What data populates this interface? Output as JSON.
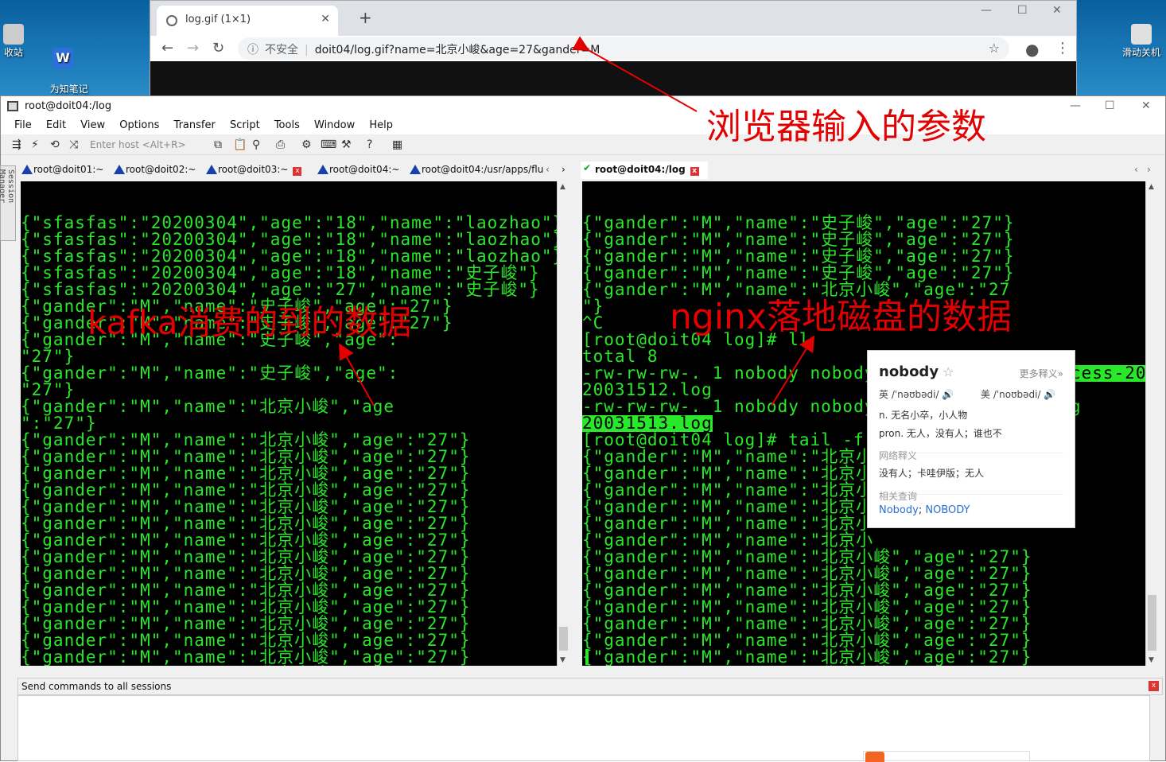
{
  "desktop": {
    "icons": [
      {
        "label": "收站"
      },
      {
        "label": "为知笔记\nWiz"
      },
      {
        "label": "滑动关机"
      }
    ]
  },
  "browser": {
    "tab_title": "log.gif (1×1)",
    "insecure_label": "不安全",
    "url": "doit04/log.gif?name=北京小峻&age=27&gander=M"
  },
  "terminal": {
    "window_title": "root@doit04:/log",
    "menu": [
      "File",
      "Edit",
      "View",
      "Options",
      "Transfer",
      "Script",
      "Tools",
      "Window",
      "Help"
    ],
    "enter_host_placeholder": "Enter host <Alt+R>",
    "session_manager_label": "Session Manager",
    "left_tabs": [
      "root@doit01:~",
      "root@doit02:~",
      "root@doit03:~",
      "root@doit04:~",
      "root@doit04:/usr/apps/flu"
    ],
    "right_tab": "root@doit04:/log",
    "left_lines": [
      "{\"sfasfas\":\"20200304\",\"age\":\"18\",\"name\":\"laozhao\"}",
      "{\"sfasfas\":\"20200304\",\"age\":\"18\",\"name\":\"laozhao\"}",
      "{\"sfasfas\":\"20200304\",\"age\":\"18\",\"name\":\"laozhao\"}",
      "{\"sfasfas\":\"20200304\",\"age\":\"18\",\"name\":\"史子峻\"}",
      "{\"sfasfas\":\"20200304\",\"age\":\"27\",\"name\":\"史子峻\"}",
      "{\"gander\":\"M\",\"name\":\"史子峻\",\"age\":\"27\"}",
      "{\"gander\":\"M\",\"name\":\"史子峻\",\"age\":\"27\"}",
      "{\"gander\":\"M\",\"name\":\"史子峻\",\"age\":",
      "\"27\"}",
      "{\"gander\":\"M\",\"name\":\"史子峻\",\"age\":",
      "\"27\"}",
      "{\"gander\":\"M\",\"name\":\"北京小峻\",\"age",
      "\":\"27\"}",
      "{\"gander\":\"M\",\"name\":\"北京小峻\",\"age\":\"27\"}",
      "{\"gander\":\"M\",\"name\":\"北京小峻\",\"age\":\"27\"}",
      "{\"gander\":\"M\",\"name\":\"北京小峻\",\"age\":\"27\"}",
      "{\"gander\":\"M\",\"name\":\"北京小峻\",\"age\":\"27\"}",
      "{\"gander\":\"M\",\"name\":\"北京小峻\",\"age\":\"27\"}",
      "{\"gander\":\"M\",\"name\":\"北京小峻\",\"age\":\"27\"}",
      "{\"gander\":\"M\",\"name\":\"北京小峻\",\"age\":\"27\"}",
      "{\"gander\":\"M\",\"name\":\"北京小峻\",\"age\":\"27\"}",
      "{\"gander\":\"M\",\"name\":\"北京小峻\",\"age\":\"27\"}",
      "{\"gander\":\"M\",\"name\":\"北京小峻\",\"age\":\"27\"}",
      "{\"gander\":\"M\",\"name\":\"北京小峻\",\"age\":\"27\"}",
      "{\"gander\":\"M\",\"name\":\"北京小峻\",\"age\":\"27\"}",
      "{\"gander\":\"M\",\"name\":\"北京小峻\",\"age\":\"27\"}",
      "{\"gander\":\"M\",\"name\":\"北京小峻\",\"age\":\"27\"}",
      "{\"gander\":\"M\",\"name\":\"北京小峻\",\"age\":\"27\"}"
    ],
    "right_lines": [
      "{\"gander\":\"M\",\"name\":\"史子峻\",\"age\":\"27\"}",
      "{\"gander\":\"M\",\"name\":\"史子峻\",\"age\":\"27\"}",
      "{\"gander\":\"M\",\"name\":\"史子峻\",\"age\":\"27\"}",
      "{\"gander\":\"M\",\"name\":\"史子峻\",\"age\":\"27\"}",
      "{\"gander\":\"M\",\"name\":\"北京小峻\",\"age\":\"27",
      "\"}",
      "^C",
      "[root@doit04 log]# ll",
      "total 8",
      "-rw-rw-rw-. 1 nobody nobody 538 Mar 15 12:51 access-20",
      "20031512.log",
      "-rw-rw-rw-. 1 nobody nobody",
      "20031513.log",
      "[root@doit04 log]# tail -f",
      "{\"gander\":\"M\",\"name\":\"北京小",
      "{\"gander\":\"M\",\"name\":\"北京小",
      "{\"gander\":\"M\",\"name\":\"北京小",
      "{\"gander\":\"M\",\"name\":\"北京小",
      "{\"gander\":\"M\",\"name\":\"北京小",
      "{\"gander\":\"M\",\"name\":\"北京小",
      "{\"gander\":\"M\",\"name\":\"北京小峻\",\"age\":\"27\"}",
      "{\"gander\":\"M\",\"name\":\"北京小峻\",\"age\":\"27\"}",
      "{\"gander\":\"M\",\"name\":\"北京小峻\",\"age\":\"27\"}",
      "{\"gander\":\"M\",\"name\":\"北京小峻\",\"age\":\"27\"}",
      "{\"gander\":\"M\",\"name\":\"北京小峻\",\"age\":\"27\"}",
      "{\"gander\":\"M\",\"name\":\"北京小峻\",\"age\":\"27\"}",
      "{\"gander\":\"M\",\"name\":\"北京小峻\",\"age\":\"27\"}",
      "{\"gander\":\"M\",\"name\":\"北京小峻\",\"age\":\"27\"}"
    ],
    "right_highlight_line": "cess-20",
    "right_tail_suffix": "g",
    "send_commands_label": "Send commands to all sessions"
  },
  "annotations": {
    "browser_params": "浏览器输入的参数",
    "kafka": "kafka消费的到的数据",
    "nginx": "nginx落地磁盘的数据"
  },
  "dictionary_popup": {
    "word": "nobody",
    "more": "更多释义»",
    "uk": "英 /ˈnəʊbədi/",
    "us": "美 /ˈnoʊbədi/",
    "def_n": "n. 无名小卒，小人物",
    "def_pron": "pron. 无人，没有人；谁也不",
    "web_header": "网络释义",
    "web_def": "没有人；卡哇伊版；无人",
    "related_header": "相关查询",
    "related_1": "Nobody",
    "related_sep": ";",
    "related_2": "NOBODY"
  },
  "colors": {
    "terminal_green": "#29e829",
    "annotation_red": "#e30000"
  }
}
